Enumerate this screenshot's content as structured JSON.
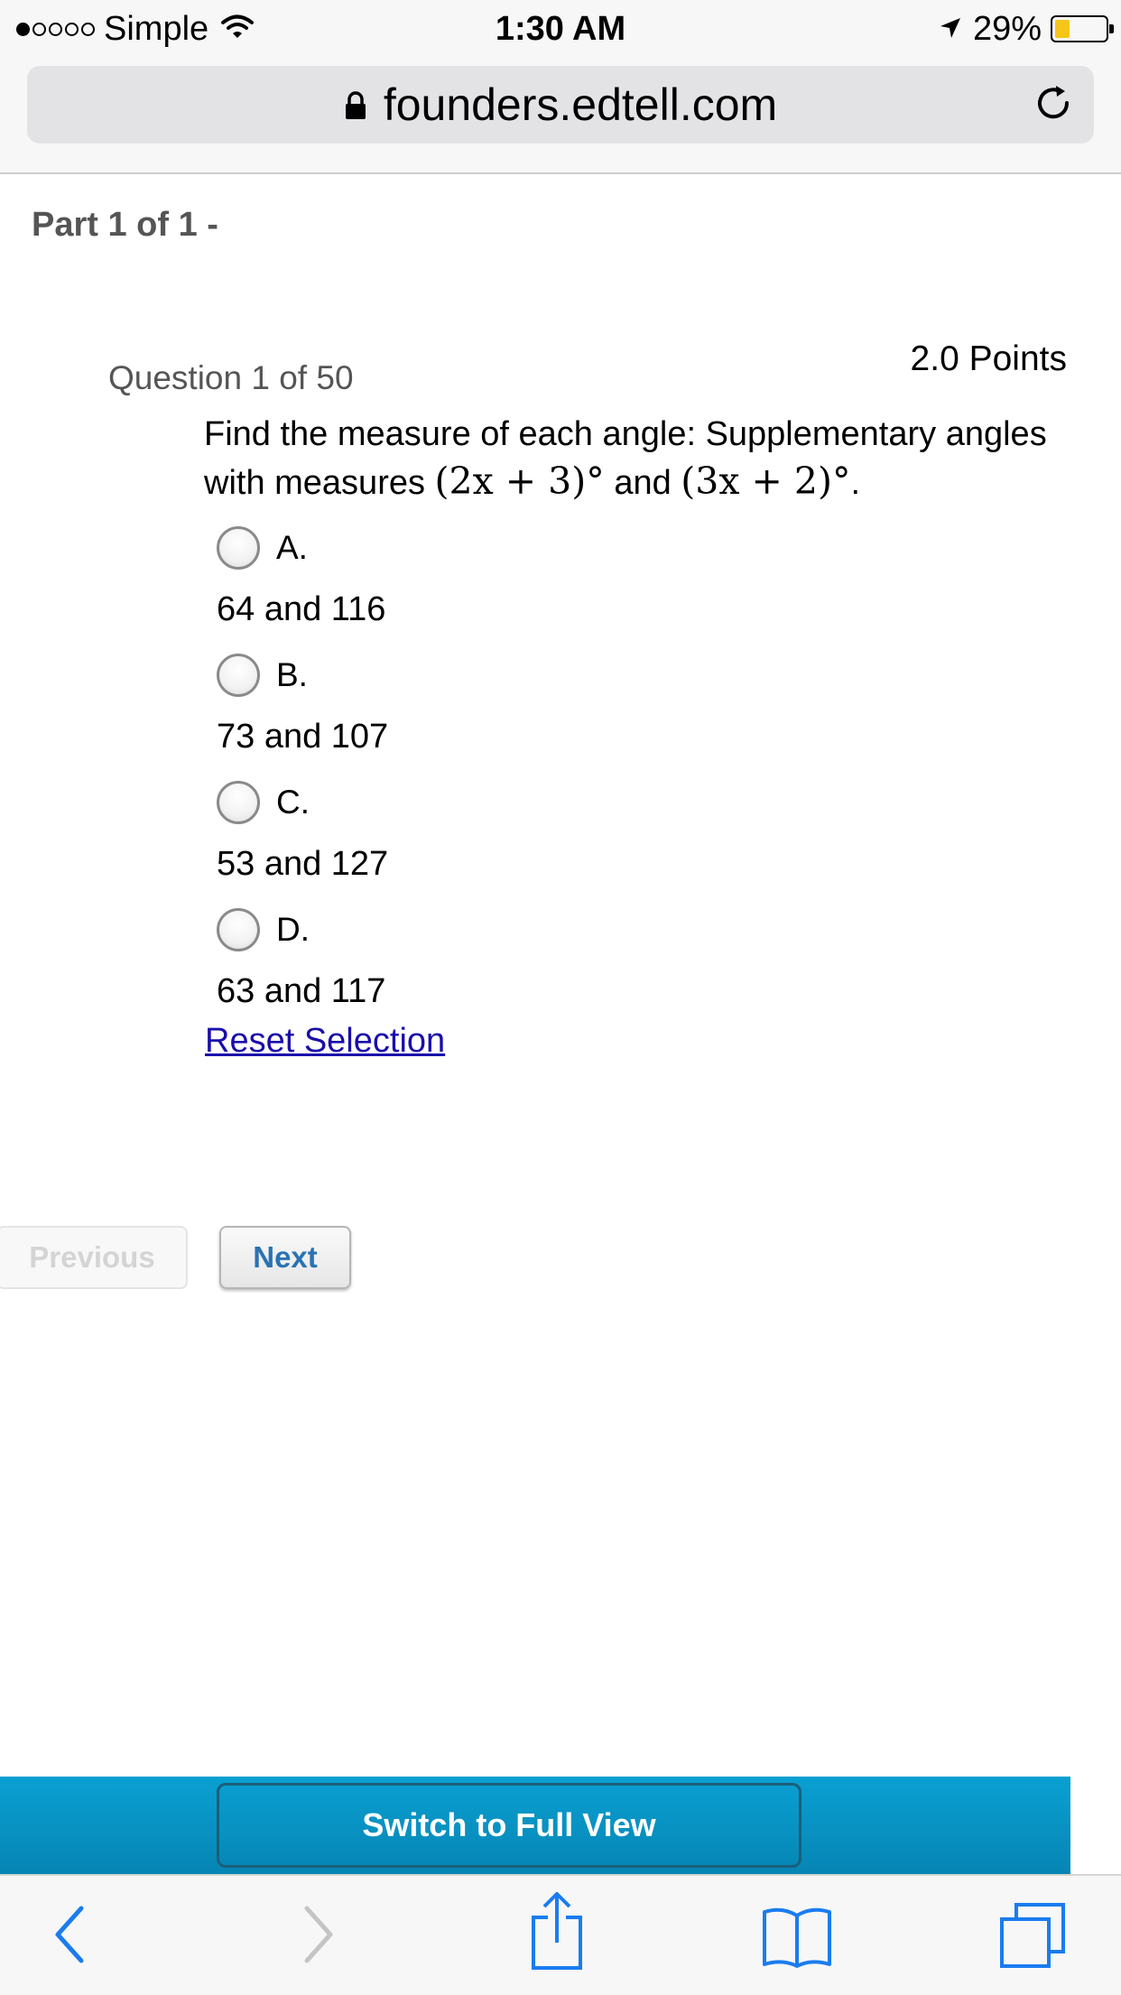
{
  "status_bar": {
    "carrier": "Simple",
    "time": "1:30 AM",
    "battery": "29%",
    "battery_level": 0.29,
    "signal_bars": 1
  },
  "browser": {
    "url": "founders.edtell.com",
    "icons": [
      "lock-icon",
      "reload-icon",
      "back-icon",
      "forward-icon",
      "share-icon",
      "bookmarks-icon",
      "tabs-icon"
    ]
  },
  "page": {
    "part_label": "Part 1 of 1 -",
    "question_number": "Question 1 of 50",
    "points": "2.0 Points",
    "question_text": "Find the measure of each angle: Supplementary angles with measures",
    "expr1": "(2x + 3)°",
    "conjunction": "and",
    "expr2": "(3x + 2)°",
    "period": ".",
    "options": [
      {
        "letter": "A.",
        "answer": "64 and 116"
      },
      {
        "letter": "B.",
        "answer": "73 and 107"
      },
      {
        "letter": "C.",
        "answer": "53 and 127"
      },
      {
        "letter": "D.",
        "answer": "63 and 117"
      }
    ],
    "reset_label": "Reset Selection",
    "previous_label": "Previous",
    "next_label": "Next",
    "full_view_label": "Switch to Full View"
  }
}
